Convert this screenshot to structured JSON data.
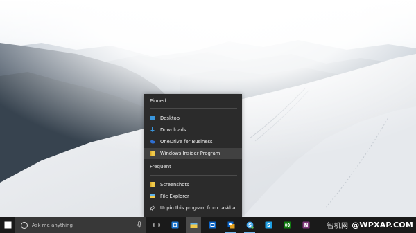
{
  "jumplist": {
    "pinned_header": "Pinned",
    "pinned": [
      {
        "label": "Desktop",
        "icon": "desktop-folder-icon"
      },
      {
        "label": "Downloads",
        "icon": "downloads-folder-icon"
      },
      {
        "label": "OneDrive for Business",
        "icon": "onedrive-icon"
      },
      {
        "label": "Windows Insider Program",
        "icon": "folder-icon"
      }
    ],
    "frequent_header": "Frequent",
    "frequent": [
      {
        "label": "Screenshots",
        "icon": "folder-icon"
      }
    ],
    "tasks": [
      {
        "label": "File Explorer",
        "icon": "file-explorer-icon"
      },
      {
        "label": "Unpin this program from taskbar",
        "icon": "unpin-icon"
      }
    ]
  },
  "taskbar": {
    "search_placeholder": "Ask me anything",
    "apps": [
      {
        "name": "task-view",
        "icon": "task-view-icon",
        "state": "none"
      },
      {
        "name": "edge",
        "icon": "edge-icon",
        "state": "none"
      },
      {
        "name": "file-explorer",
        "icon": "file-explorer-icon",
        "state": "active"
      },
      {
        "name": "outlook",
        "icon": "outlook-icon",
        "state": "none"
      },
      {
        "name": "outlook-2",
        "icon": "outlook-icon",
        "state": "running"
      },
      {
        "name": "skype-business",
        "icon": "skype-icon",
        "state": "running"
      },
      {
        "name": "skype",
        "icon": "skype-icon",
        "state": "none"
      },
      {
        "name": "xbox",
        "icon": "xbox-icon",
        "state": "none"
      },
      {
        "name": "onenote",
        "icon": "onenote-icon",
        "state": "none"
      }
    ]
  },
  "watermark": {
    "cn": "智机网",
    "text": "@WPXAP.COM"
  },
  "colors": {
    "accent": "#76b9ed",
    "jumplist_bg": "#2b2b2b",
    "taskbar_bg": "#1a1a1a",
    "search_bg": "#383838"
  }
}
